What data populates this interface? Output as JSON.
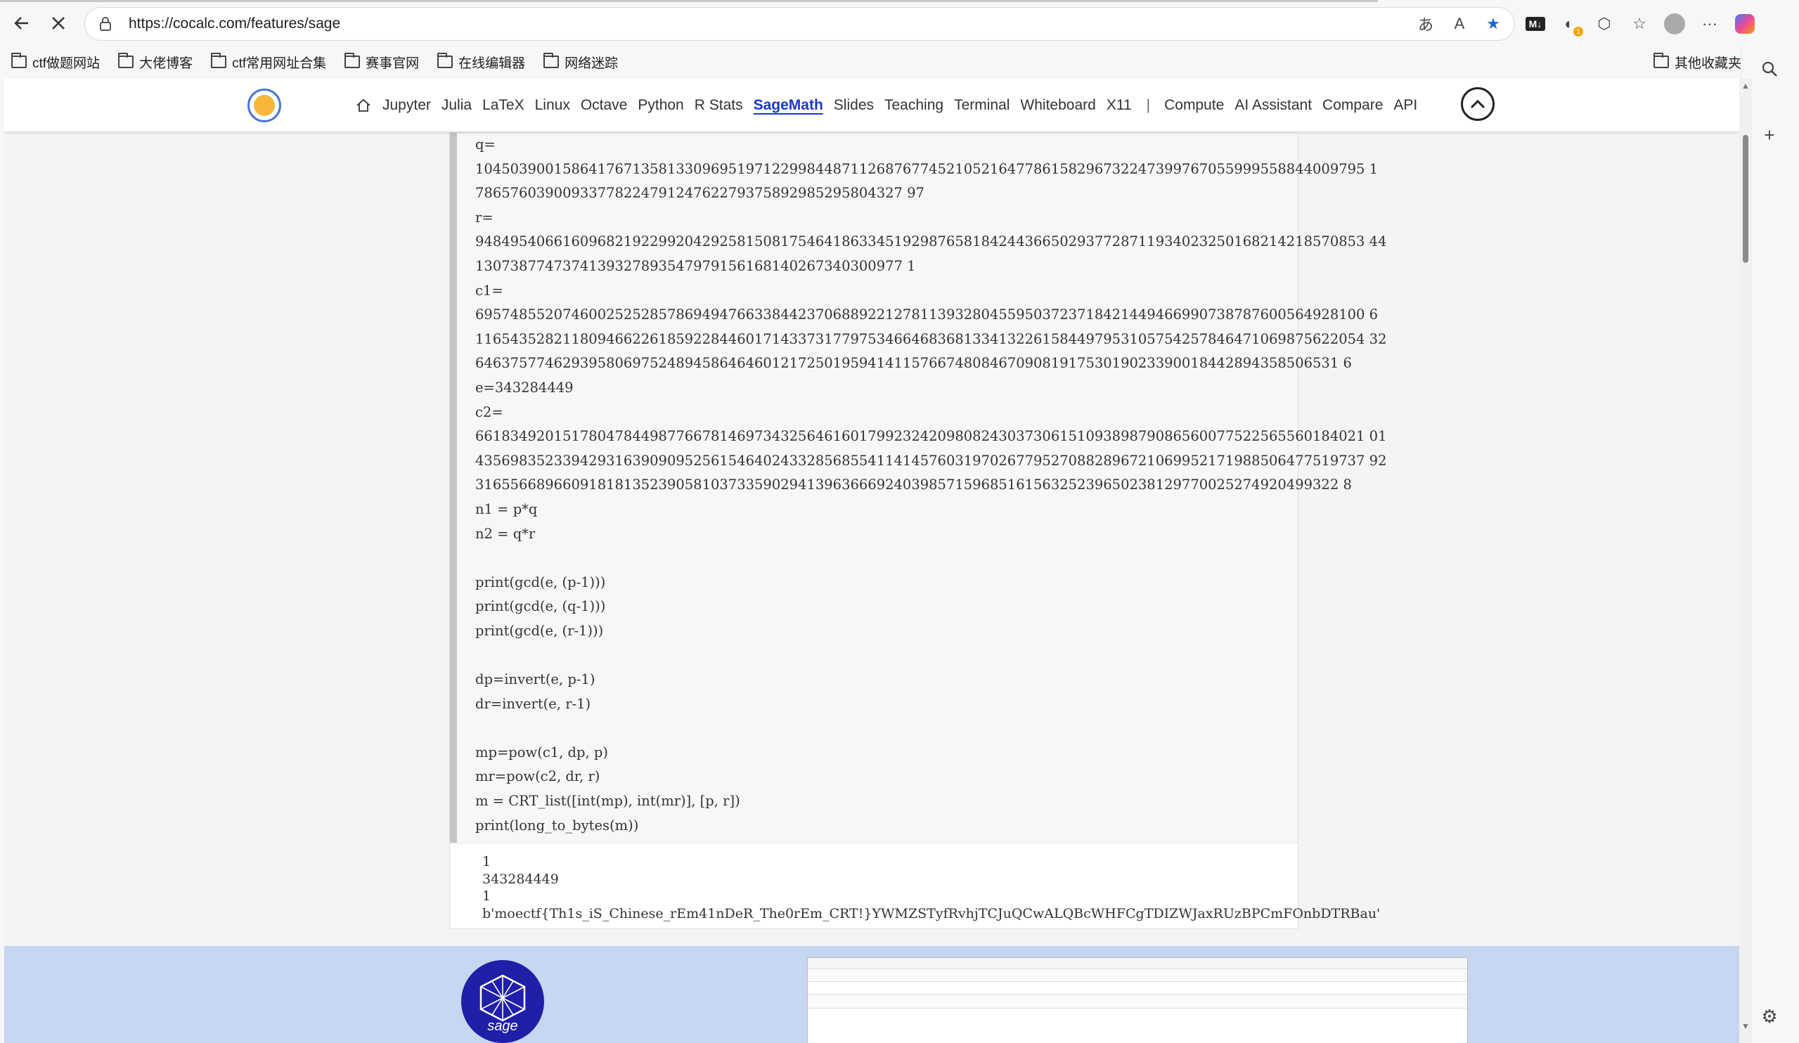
{
  "browser": {
    "url": "https://cocalc.com/features/sage",
    "bookmarks": [
      "ctf做题网站",
      "大佬博客",
      "ctf常用网址合集",
      "赛事官网",
      "在线编辑器",
      "网络迷踪"
    ],
    "other_bookmarks": "其他收藏夹"
  },
  "nav": {
    "links": [
      "Jupyter",
      "Julia",
      "LaTeX",
      "Linux",
      "Octave",
      "Python",
      "R Stats",
      "SageMath",
      "Slides",
      "Teaching",
      "Terminal",
      "Whiteboard",
      "X11",
      "|",
      "Compute",
      "AI Assistant",
      "Compare",
      "API"
    ],
    "active": "SageMath"
  },
  "code": {
    "lines": [
      "q=",
      "104503900158641767135813309695197122998448711268767745210521647786158296732247399767055999558844009795 1",
      "7865760390093377822479124762279375892985295804327 97",
      "r=",
      "948495406616096821922992042925815081754641863345192987658184244366502937728711934023250168214218570853 44",
      "1307387747374139327893547979156168140267340300977 1",
      "c1=",
      "695748552074600252528578694947663384423706889221278113932804559503723718421449466990738787600564928100 6",
      "116543528211809466226185922844601714337317797534664683681334132261584497953105754257846471069875622054 32",
      "646375774629395806975248945864646012172501959414115766748084670908191753019023390018442894358506531 6",
      "e=343284449",
      "c2=",
      "661834920151780478449877667814697343256461601799232420980824303730615109389879086560077522565560184021 01",
      "435698352339429316390909525615464024332856855411414576031970267795270882896721069952171988506477519737 92",
      "316556689660918181352390581037335902941396366692403985715968516156325239650238129770025274920499322 8",
      "n1 = p*q",
      "n2 = q*r",
      "",
      "print(gcd(e, (p-1)))",
      "print(gcd(e, (q-1)))",
      "print(gcd(e, (r-1)))",
      "",
      "dp=invert(e, p-1)",
      "dr=invert(e, r-1)",
      "",
      "mp=pow(c1, dp, p)",
      "mr=pow(c2, dr, r)",
      "m = CRT_list([int(mp), int(mr)], [p, r])",
      "print(long_to_bytes(m))"
    ]
  },
  "output": {
    "lines": [
      "1",
      "343284449",
      "1",
      "b'moectf{Th1s_iS_Chinese_rEm41nDeR_The0rEm_CRT!}YWMZSTyfRvhjTCJuQCwALQBcWHFCgTDIZWJaxRUzBPCmFOnbDTRBau'"
    ]
  },
  "footer": {
    "logo_text": "sage"
  }
}
